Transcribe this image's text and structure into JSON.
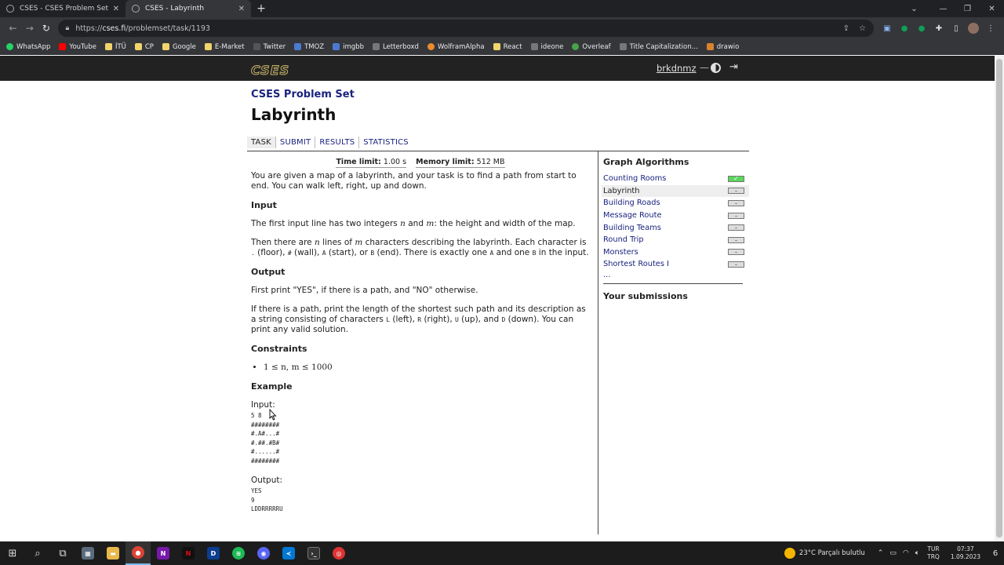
{
  "browser": {
    "tabs": [
      {
        "title": "CSES - CSES Problem Set - Tasks",
        "active": false
      },
      {
        "title": "CSES - Labyrinth",
        "active": true
      }
    ],
    "new_tab": "+",
    "url_prefix": "https://",
    "url_host": "cses.fi",
    "url_path": "/problemset/task/1193",
    "bookmarks": [
      {
        "label": "WhatsApp",
        "icon": "whatsapp-icon"
      },
      {
        "label": "YouTube",
        "icon": "youtube-icon"
      },
      {
        "label": "İTÜ",
        "icon": "folder-icon"
      },
      {
        "label": "CP",
        "icon": "folder-icon"
      },
      {
        "label": "Google",
        "icon": "folder-icon"
      },
      {
        "label": "E-Market",
        "icon": "folder-icon"
      },
      {
        "label": "Twitter",
        "icon": "twitter-icon"
      },
      {
        "label": "TMOZ",
        "icon": "tmoz-icon"
      },
      {
        "label": "imgbb",
        "icon": "imgbb-icon"
      },
      {
        "label": "Letterboxd",
        "icon": "letterboxd-icon"
      },
      {
        "label": "WolframAlpha",
        "icon": "wolfram-icon"
      },
      {
        "label": "React",
        "icon": "folder-icon"
      },
      {
        "label": "ideone",
        "icon": "ideone-icon"
      },
      {
        "label": "Overleaf",
        "icon": "overleaf-icon"
      },
      {
        "label": "Title Capitalization...",
        "icon": "title-cap-icon"
      },
      {
        "label": "drawio",
        "icon": "drawio-icon"
      }
    ]
  },
  "header": {
    "logo": "CSES",
    "username": "brkdnmz",
    "dash": "—"
  },
  "page": {
    "subtitle": "CSES Problem Set",
    "title": "Labyrinth",
    "tabs": [
      "TASK",
      "SUBMIT",
      "RESULTS",
      "STATISTICS"
    ],
    "limits": {
      "time_label": "Time limit:",
      "time_value": "1.00 s",
      "memory_label": "Memory limit:",
      "memory_value": "512 MB"
    },
    "intro": "You are given a map of a labyrinth, and your task is to find a path from start to end. You can walk left, right, up and down.",
    "input_heading": "Input",
    "input_p1_a": "The first input line has two integers",
    "input_p1_n": "n",
    "input_p1_and": "and",
    "input_p1_m": "m",
    "input_p1_b": ": the height and width of the map.",
    "input_p2_a": "Then there are",
    "input_p2_n": "n",
    "input_p2_b": "lines of",
    "input_p2_m": "m",
    "input_p2_c": "characters describing the labyrinth. Each character is",
    "floor_char": ".",
    "floor_label": "(floor),",
    "wall_char": "#",
    "wall_label": "(wall),",
    "start_char": "A",
    "start_label": "(start), or",
    "end_char": "B",
    "end_label": "(end). There is exactly one",
    "one_a": "A",
    "and_one": "and one",
    "one_b": "B",
    "in_input": "in the input.",
    "output_heading": "Output",
    "output_p1": "First print \"YES\", if there is a path, and \"NO\" otherwise.",
    "output_p2_a": "If there is a path, print the length of the shortest such path and its description as a string consisting of characters",
    "L": "L",
    "left": "(left),",
    "R": "R",
    "right": "(right),",
    "U": "U",
    "up": "(up), and",
    "D": "D",
    "down": "(down). You can print any valid solution.",
    "constraints_heading": "Constraints",
    "constraint": "1 ≤ n, m ≤ 1000",
    "example_heading": "Example",
    "example_input_label": "Input:",
    "example_input": "5 8\n########\n#.A#...#\n#.##.#B#\n#......#\n########",
    "example_output_label": "Output:",
    "example_output": "YES\n9\nLDDRRRRRU"
  },
  "sidebar": {
    "title": "Graph Algorithms",
    "items": [
      {
        "label": "Counting Rooms",
        "status": "✓",
        "solved": true,
        "current": false
      },
      {
        "label": "Labyrinth",
        "status": "–",
        "solved": false,
        "current": true
      },
      {
        "label": "Building Roads",
        "status": "–",
        "solved": false,
        "current": false
      },
      {
        "label": "Message Route",
        "status": "–",
        "solved": false,
        "current": false
      },
      {
        "label": "Building Teams",
        "status": "–",
        "solved": false,
        "current": false
      },
      {
        "label": "Round Trip",
        "status": "–",
        "solved": false,
        "current": false
      },
      {
        "label": "Monsters",
        "status": "–",
        "solved": false,
        "current": false
      },
      {
        "label": "Shortest Routes I",
        "status": "–",
        "solved": false,
        "current": false
      }
    ],
    "more": "...",
    "submissions_title": "Your submissions"
  },
  "taskbar": {
    "weather": "23°C  Parçalı bulutlu",
    "lang_top": "TUR",
    "lang_bottom": "TRQ",
    "time": "07:37",
    "date": "1.09.2023",
    "notif_count": "6"
  }
}
